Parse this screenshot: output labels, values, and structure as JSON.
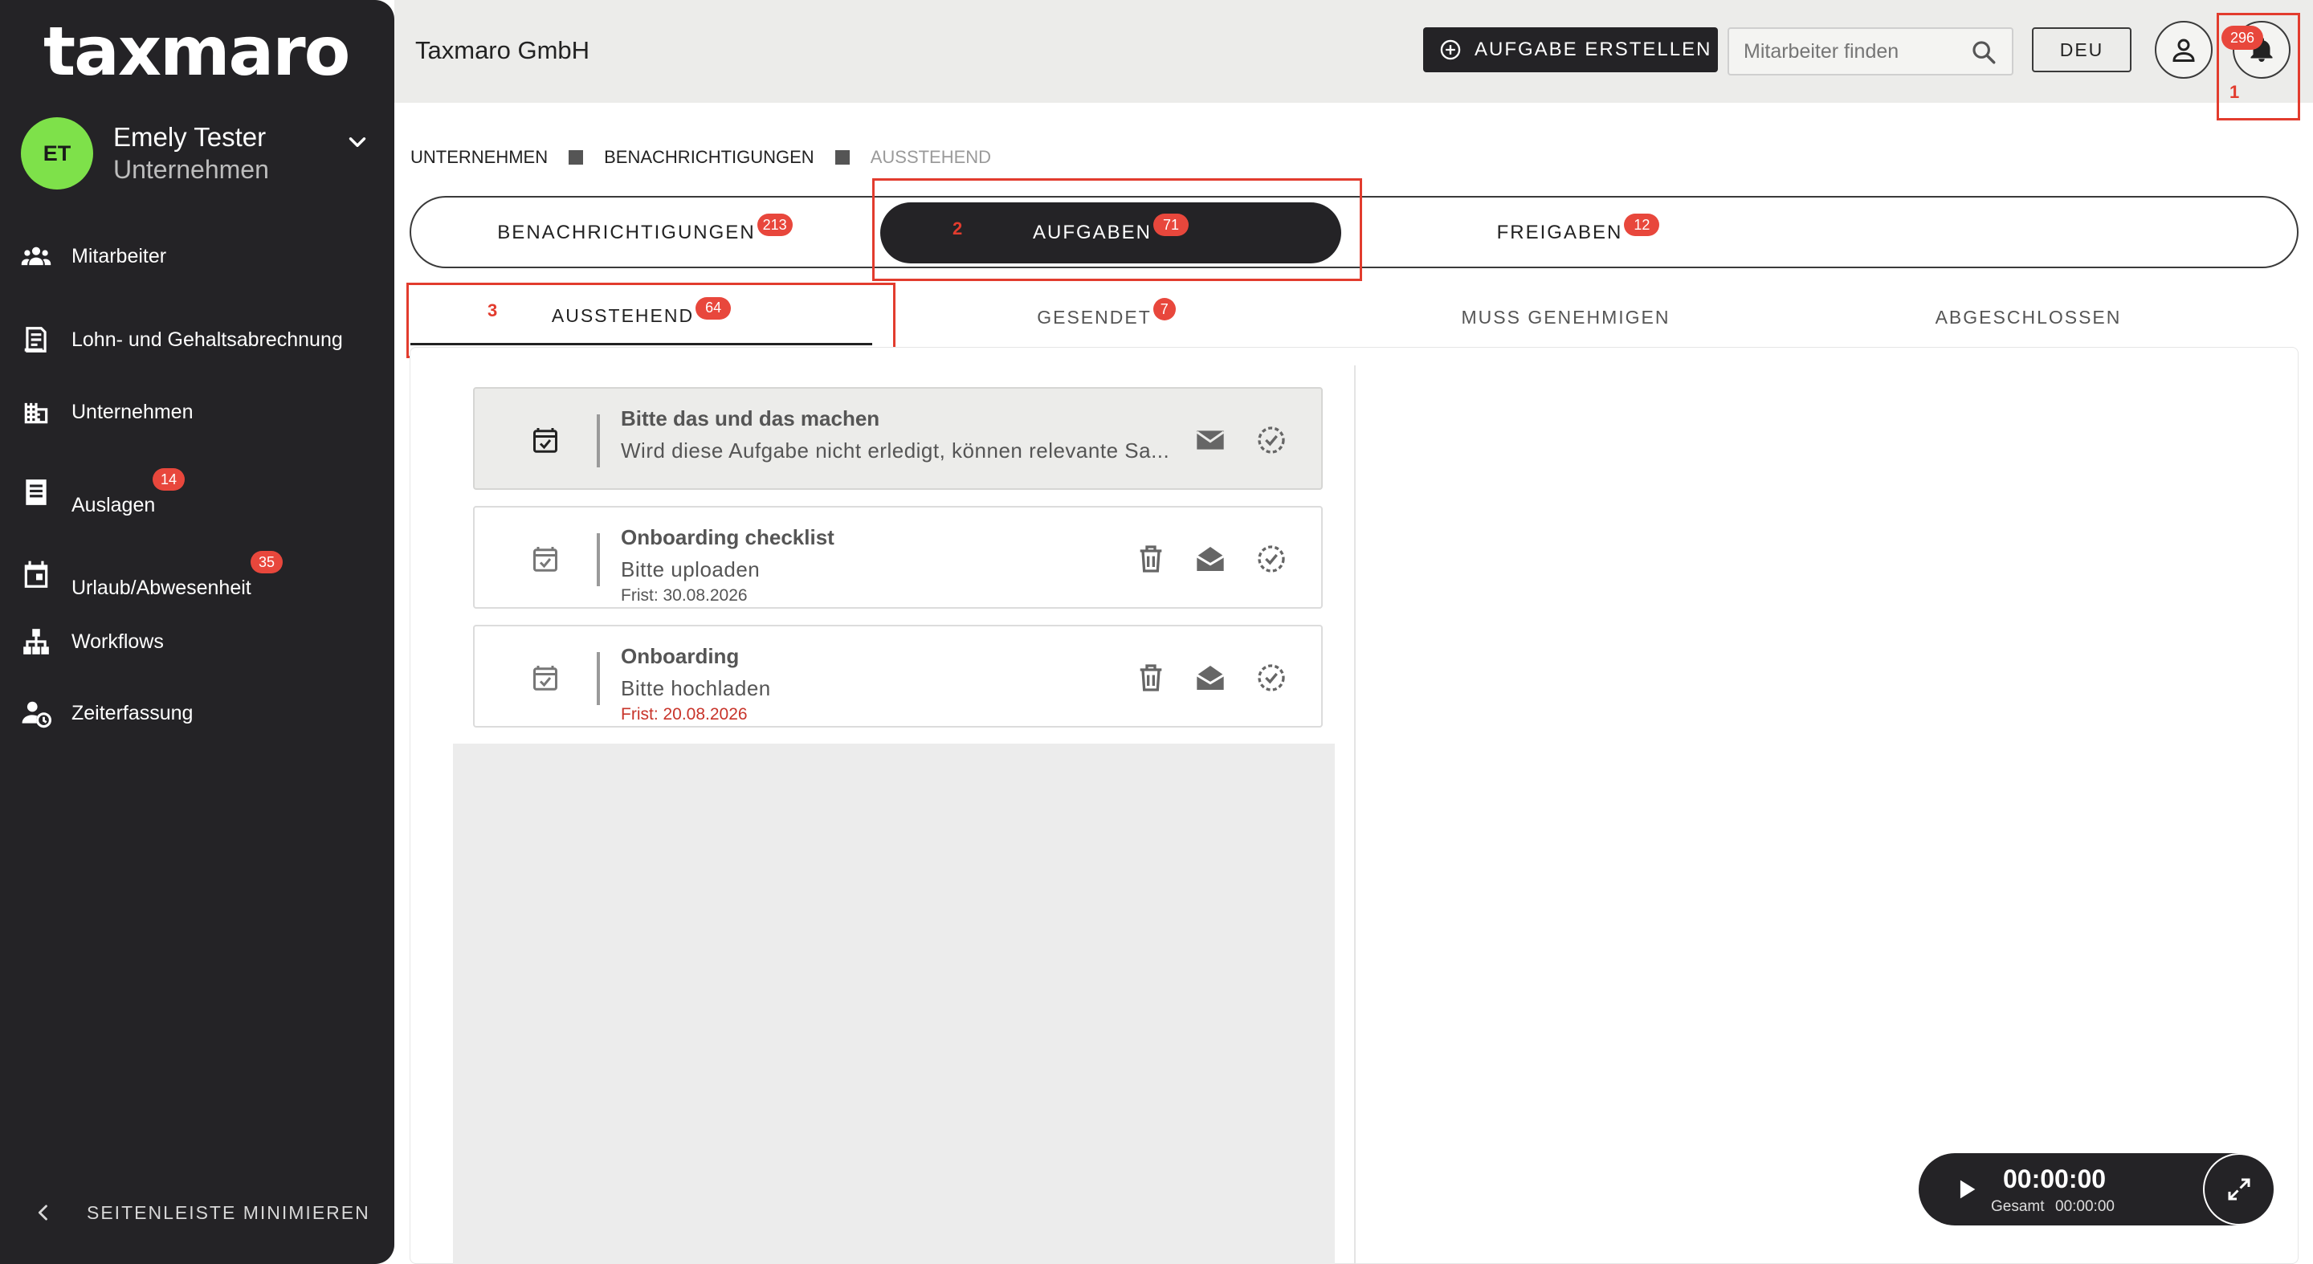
{
  "app": {
    "logo": "taxmaro",
    "company": "Taxmaro GmbH"
  },
  "user": {
    "initials": "ET",
    "name": "Emely Tester",
    "role": "Unternehmen"
  },
  "sidebar": {
    "items": [
      {
        "label": "Mitarbeiter",
        "icon": "people-icon"
      },
      {
        "label": "Lohn- und Gehaltsabrechnung",
        "icon": "payroll-icon"
      },
      {
        "label": "Unternehmen",
        "icon": "building-icon"
      },
      {
        "label": "Auslagen",
        "icon": "receipt-icon",
        "badge": "14"
      },
      {
        "label": "Urlaub/Abwesenheit",
        "icon": "calendar-icon",
        "badge": "35"
      },
      {
        "label": "Workflows",
        "icon": "hierarchy-icon"
      },
      {
        "label": "Zeiterfassung",
        "icon": "person-clock-icon"
      }
    ],
    "collapse_label": "SEITENLEISTE MINIMIEREN"
  },
  "header": {
    "create_task_label": "AUFGABE ERSTELLEN",
    "search_placeholder": "Mitarbeiter finden",
    "language": "DEU",
    "notifications_badge": "296"
  },
  "annotations": {
    "one": "1",
    "two": "2",
    "three": "3"
  },
  "breadcrumb": [
    "UNTERNEHMEN",
    "BENACHRICHTIGUNGEN",
    "AUSSTEHEND"
  ],
  "main_tabs": [
    {
      "label": "BENACHRICHTIGUNGEN",
      "badge": "213"
    },
    {
      "label": "AUFGABEN",
      "badge": "71",
      "active": true
    },
    {
      "label": "FREIGABEN",
      "badge": "12"
    }
  ],
  "sub_tabs": [
    {
      "label": "AUSSTEHEND",
      "badge": "64",
      "active": true
    },
    {
      "label": "GESENDET",
      "badge": "7"
    },
    {
      "label": "MUSS GENEHMIGEN"
    },
    {
      "label": "ABGESCHLOSSEN"
    }
  ],
  "tasks": [
    {
      "title": "Bitte das und das machen",
      "subtitle": "Wird diese Aufgabe nicht erledigt, können relevante Sa...",
      "due": "",
      "selected": true
    },
    {
      "title": "Onboarding checklist",
      "subtitle": "Bitte uploaden",
      "due": "Frist: 30.08.2026"
    },
    {
      "title": "Onboarding",
      "subtitle": "Bitte hochladen",
      "due": "Frist: 20.08.2026",
      "overdue": true
    }
  ],
  "timer": {
    "time": "00:00:00",
    "total_label": "Gesamt",
    "total_value": "00:00:00"
  },
  "colors": {
    "sidebar_bg": "#242326",
    "accent_badge": "#e8473c",
    "avatar_bg": "#7ee14a",
    "annotation": "#e23c2e"
  }
}
